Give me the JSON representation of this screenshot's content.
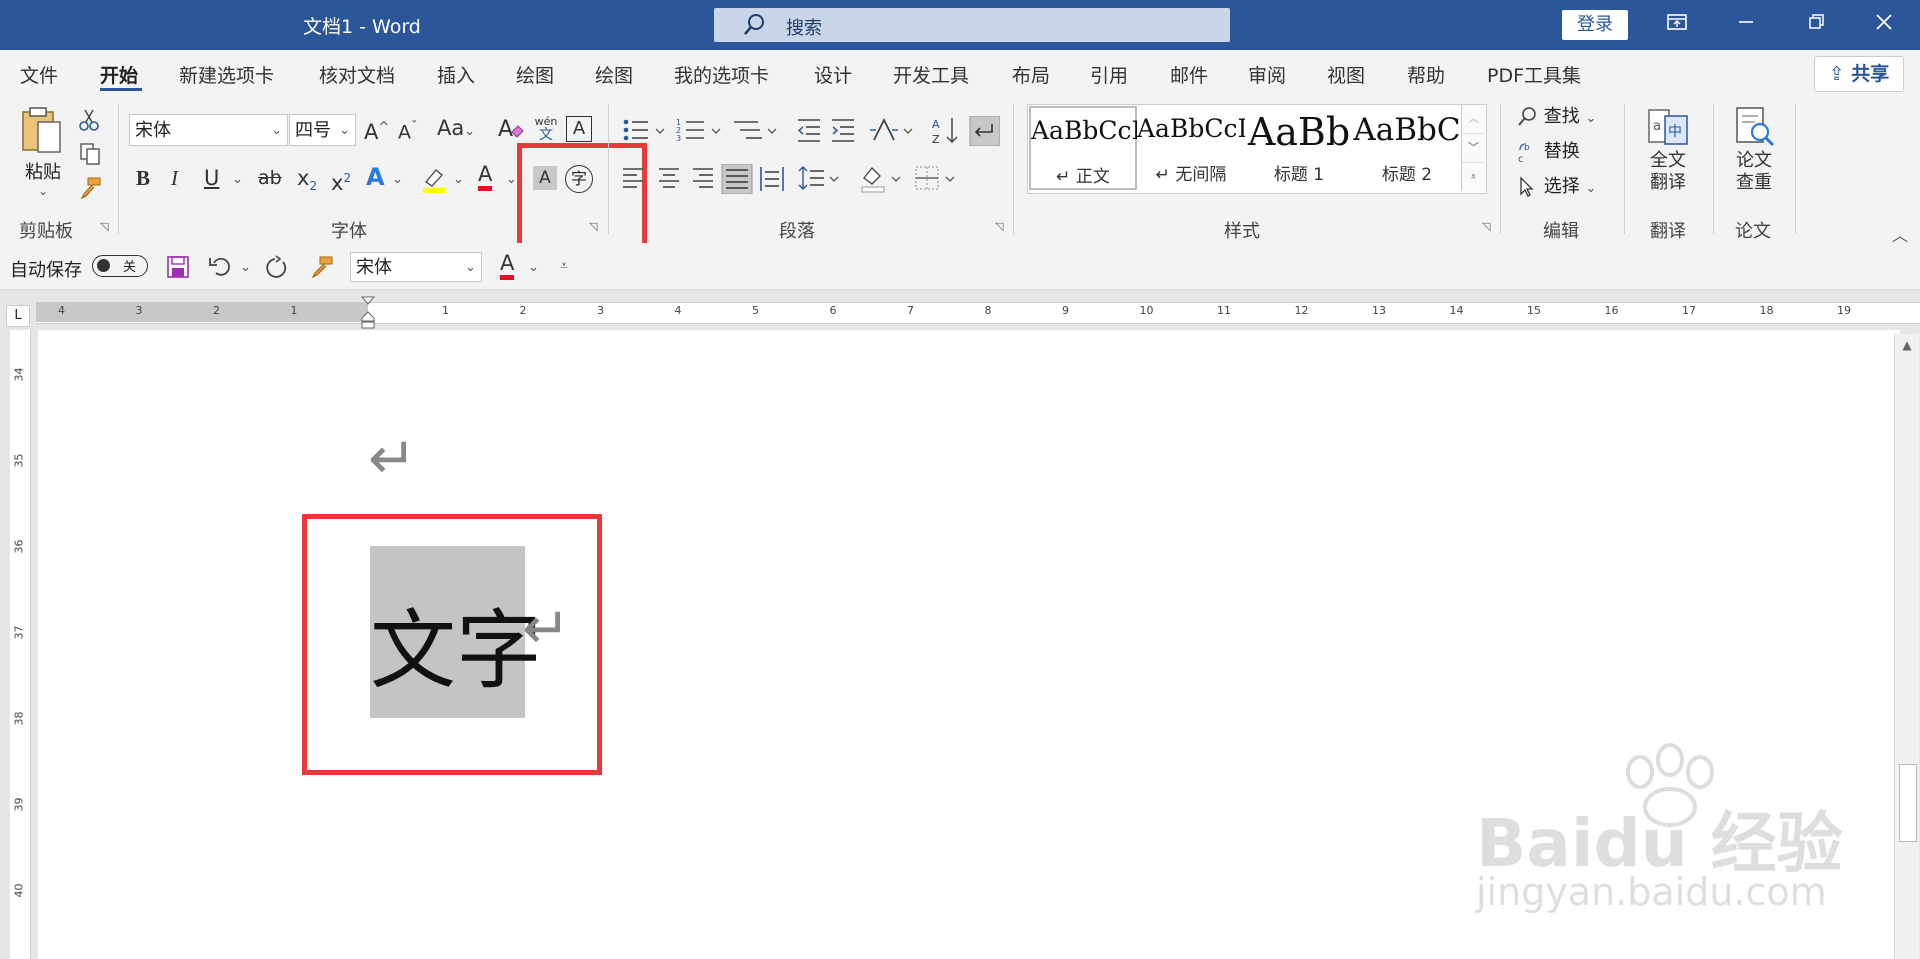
{
  "window": {
    "title": "文档1  -  Word",
    "search_placeholder": "搜索",
    "login": "登录",
    "controls": [
      "restore-ribbon-icon",
      "minimize-icon",
      "maximize-icon",
      "close-icon"
    ]
  },
  "tabs": [
    "文件",
    "开始",
    "新建选项卡",
    "核对文档",
    "插入",
    "绘图",
    "绘图",
    "我的选项卡",
    "设计",
    "开发工具",
    "布局",
    "引用",
    "邮件",
    "审阅",
    "视图",
    "帮助",
    "PDF工具集"
  ],
  "active_tab": "开始",
  "share": "共享",
  "clipboard": {
    "paste": "粘贴",
    "group": "剪贴板"
  },
  "font": {
    "name": "宋体",
    "size": "四号",
    "group": "字体",
    "grow": "A",
    "shrink": "A",
    "case": "Aa",
    "bold": "B",
    "italic": "I",
    "underline": "U",
    "strike": "ab",
    "subscript": "x",
    "superscript": "x",
    "sub_mark": "2",
    "sup_mark": "2",
    "effects": "A",
    "font_color": "A",
    "char_shading": "A",
    "enclose": "字",
    "phonetic": "wén",
    "phonetic_base": "文",
    "char_border": "A"
  },
  "paragraph": {
    "group": "段落"
  },
  "styles": {
    "group": "样式",
    "items": [
      {
        "sample": "AaBbCcI",
        "name": "↵ 正文"
      },
      {
        "sample": "AaBbCcI",
        "name": "↵ 无间隔"
      },
      {
        "sample": "AaBb",
        "name": "标题 1"
      },
      {
        "sample": "AaBbC",
        "name": "标题 2"
      }
    ]
  },
  "editing": {
    "find": "查找",
    "replace": "替换",
    "select": "选择",
    "group": "编辑"
  },
  "translate": {
    "label1": "全文",
    "label2": "翻译",
    "group": "翻译"
  },
  "paper": {
    "label1": "论文",
    "label2": "查重",
    "group": "论文"
  },
  "qat": {
    "autosave": "自动保存",
    "toggle": "关",
    "font": "宋体",
    "font_color": "A"
  },
  "ruler": {
    "tab_stop": "L",
    "left_marks": [
      "4",
      "3",
      "2",
      "1"
    ],
    "right_marks": [
      "1",
      "2",
      "3",
      "4",
      "5",
      "6",
      "7",
      "8",
      "9",
      "10",
      "11",
      "12",
      "13",
      "14",
      "15",
      "16",
      "17",
      "18",
      "19"
    ],
    "vertical_marks": [
      "34",
      "35",
      "36",
      "37",
      "38",
      "39",
      "40"
    ]
  },
  "document": {
    "text": "文字",
    "paragraph_mark": "↵"
  },
  "watermark": {
    "brand": "Baidu 经验",
    "url": "jingyan.baidu.com"
  },
  "colors": {
    "title_bar": "#2b579a",
    "highlight": "#c4c4c4",
    "annotation": "#e83a3a",
    "font_color_red": "#e81123",
    "highlighter_yellow": "#ffff00"
  }
}
